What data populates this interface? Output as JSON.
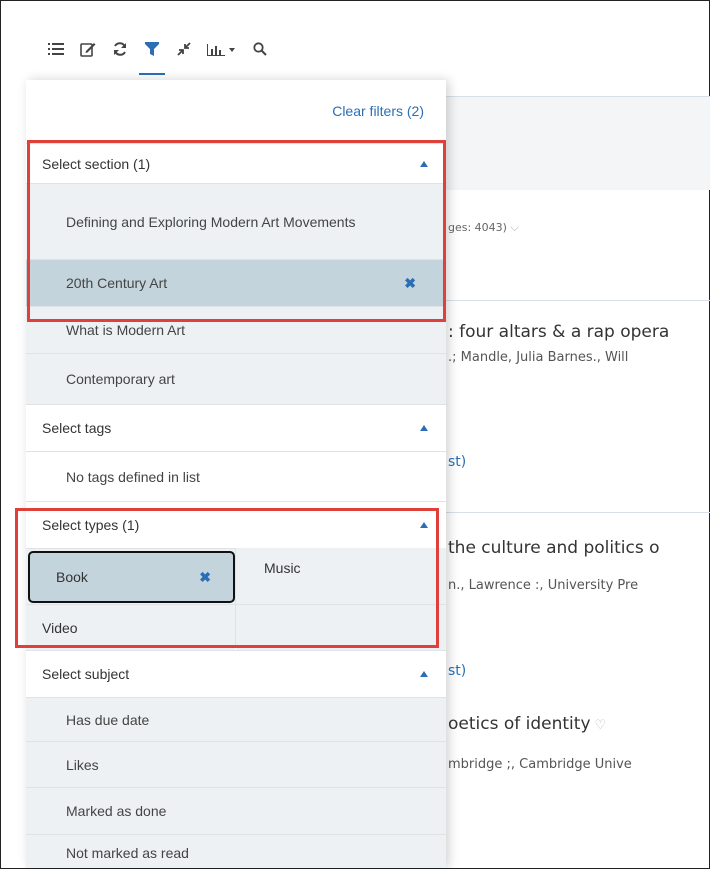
{
  "toolbar": {
    "items": [
      {
        "name": "list-view-icon",
        "active": false
      },
      {
        "name": "edit-icon",
        "active": false
      },
      {
        "name": "refresh-icon",
        "active": false
      },
      {
        "name": "filter-icon",
        "active": true
      },
      {
        "name": "collapse-icon",
        "active": false
      },
      {
        "name": "chart-icon",
        "active": false
      },
      {
        "name": "search-icon",
        "active": false
      }
    ]
  },
  "background": {
    "pages_text": "ges: 4043)",
    "items": [
      {
        "title": ": four altars & a rap opera",
        "author": ".; Mandle, Julia Barnes., Will",
        "link": "st)"
      },
      {
        "title": "the culture and politics o",
        "author": "n., Lawrence :, University Pre",
        "link": "st)"
      },
      {
        "title": "oetics of identity",
        "author": "mbridge ;, Cambridge Unive"
      }
    ]
  },
  "panel": {
    "clear_filters": "Clear filters (2)",
    "section": {
      "header": "Select section (1)",
      "options": [
        {
          "label": "Defining and Exploring Modern Art Movements",
          "selected": false
        },
        {
          "label": "20th Century Art",
          "selected": true
        },
        {
          "label": "What is Modern Art",
          "selected": false
        },
        {
          "label": "Contemporary art",
          "selected": false
        }
      ]
    },
    "tags": {
      "header": "Select tags",
      "empty": "No tags defined in list"
    },
    "types": {
      "header": "Select types (1)",
      "options": [
        {
          "label": "Book",
          "selected": true
        },
        {
          "label": "Music",
          "selected": false
        },
        {
          "label": "Video",
          "selected": false
        }
      ]
    },
    "subject": {
      "header": "Select subject",
      "options": [
        "Has due date",
        "Likes",
        "Marked as done",
        "Not marked as read"
      ]
    },
    "remove_glyph": "✖"
  }
}
